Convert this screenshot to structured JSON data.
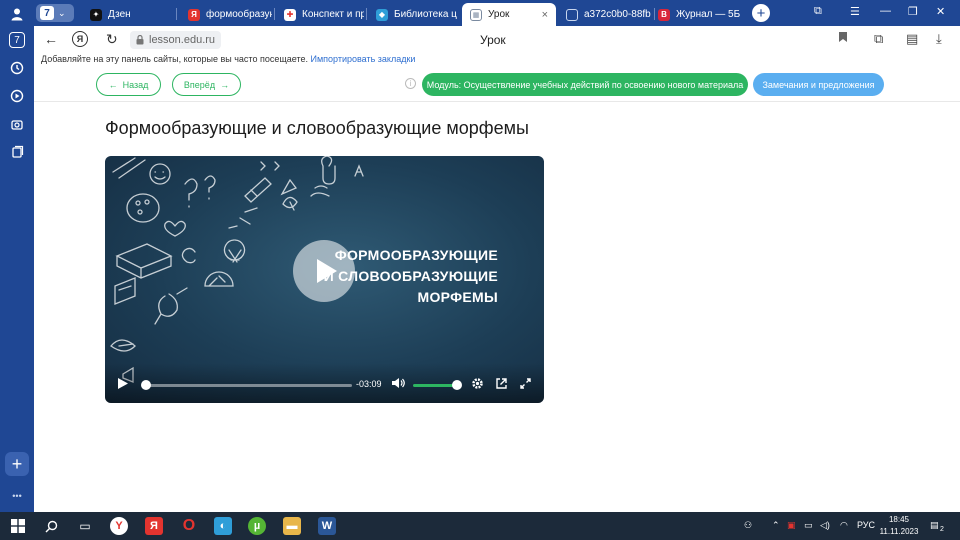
{
  "sidebar": {
    "badge": "7",
    "plus_label": "+",
    "more_label": "•••"
  },
  "tabs": {
    "counter": "7",
    "items": [
      {
        "label": "Дзен",
        "icon": "dzen-icon",
        "color": "#111111",
        "glyph": "✦"
      },
      {
        "label": "формообразую",
        "icon": "yandex-icon",
        "color": "#e3342f",
        "glyph": "Я"
      },
      {
        "label": "Конспект и пр",
        "icon": "konspekt-icon",
        "color": "#f6a21e",
        "glyph": "✚"
      },
      {
        "label": "Библиотека ц",
        "icon": "library-icon",
        "color": "#2f9ed8",
        "glyph": "◆"
      },
      {
        "label": "Урок",
        "icon": "lesson-icon",
        "color": "#7a8aa0",
        "glyph": "▦"
      },
      {
        "label": "a372c0b0-88fb",
        "icon": "document-icon",
        "color": "#7fa3d8",
        "glyph": "▯"
      },
      {
        "label": "Журнал — 5Б",
        "icon": "journal-icon",
        "color": "#d9263b",
        "glyph": "В"
      }
    ],
    "active_close": "×"
  },
  "address": {
    "url": "lesson.edu.ru",
    "page_title": "Урок"
  },
  "bookmarks": {
    "text": "Добавляйте на эту панель сайты, которые вы часто посещаете.",
    "link": "Импортировать закладки"
  },
  "toolbar": {
    "back_label": "Назад",
    "forward_label": "Вперёд",
    "module_label": "Модуль: Осуществление учебных действий по освоению нового материала",
    "remarks_label": "Замечания и предложения"
  },
  "lesson": {
    "heading": "Формообразующие и словообразующие морфемы",
    "video_title_lines": [
      "ФОРМООБРАЗУЮЩИЕ",
      "И СЛОВООБРАЗУЮЩИЕ",
      "МОРФЕМЫ"
    ],
    "time_remaining": "-03:09",
    "progress": 0.02,
    "volume": 1.0
  },
  "taskbar": {
    "lang": "РУС",
    "time": "18:45",
    "date": "11.11.2023",
    "notification_count": "2"
  }
}
